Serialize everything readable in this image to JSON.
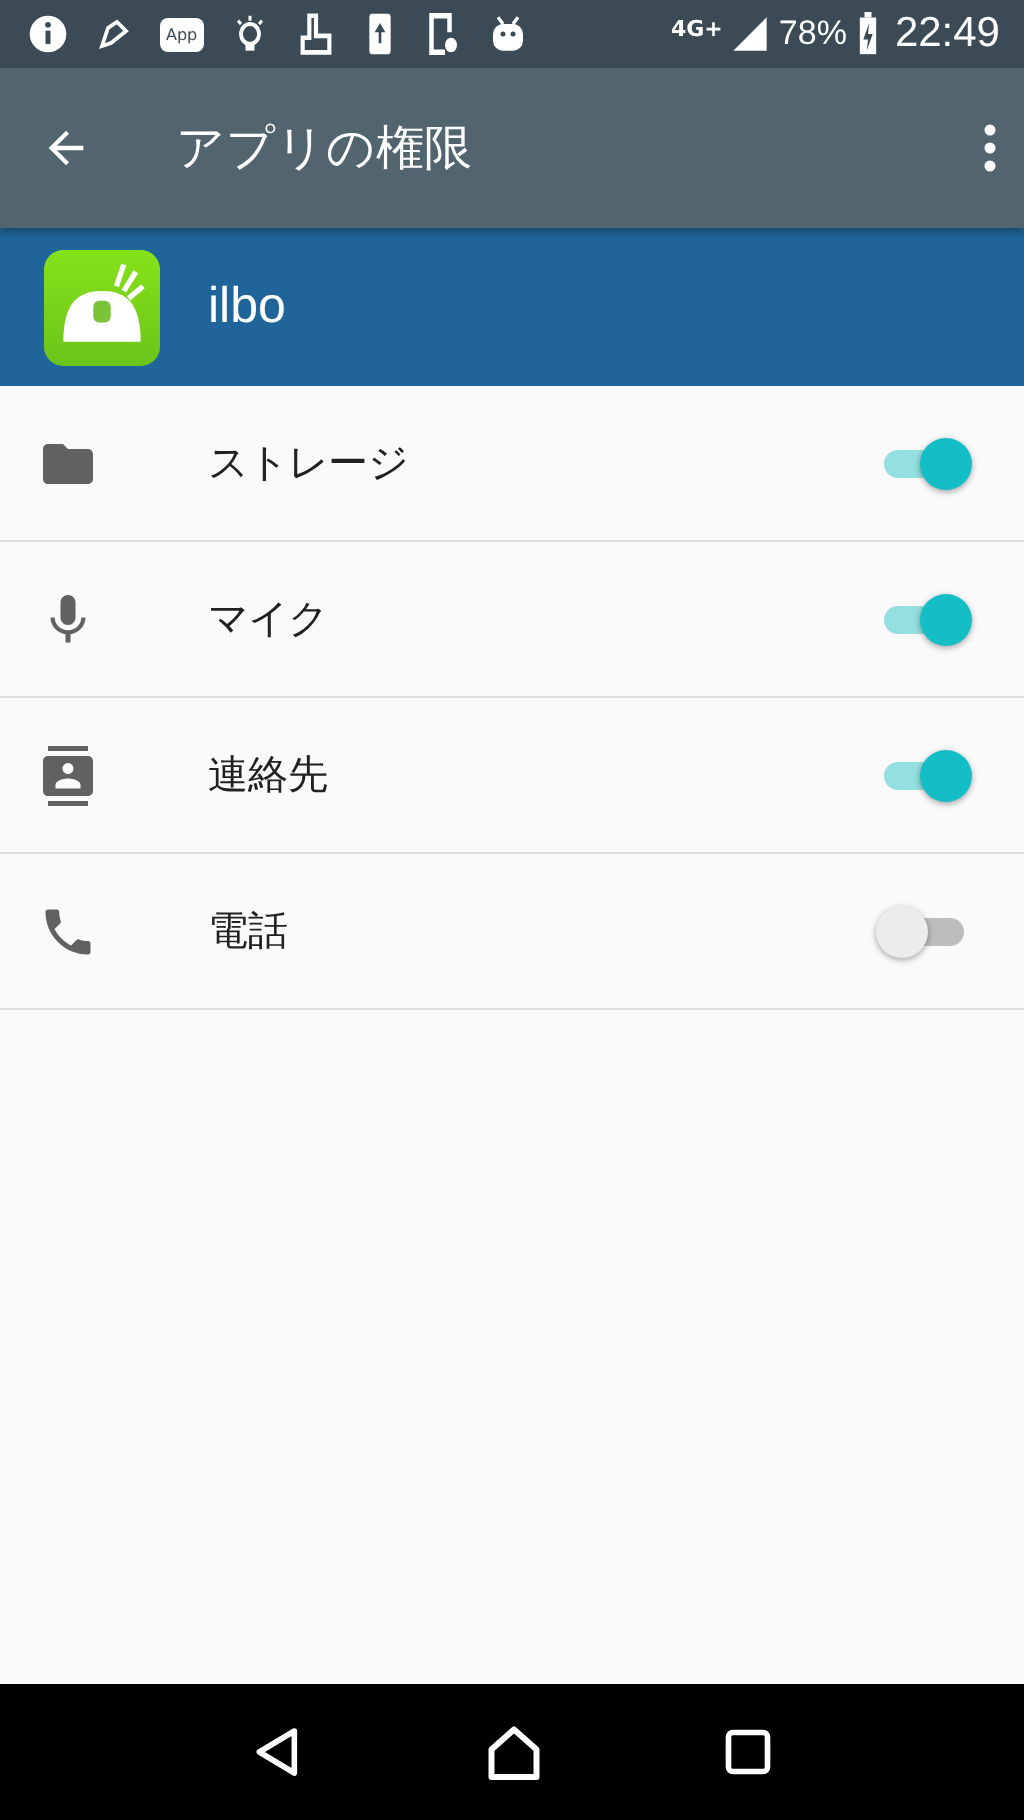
{
  "status_bar": {
    "app_badge": "App",
    "network": "4G+",
    "battery": "78%",
    "time": "22:49"
  },
  "toolbar": {
    "title": "アプリの権限"
  },
  "app": {
    "name": "ilbo"
  },
  "permissions": [
    {
      "kind": "storage",
      "label": "ストレージ",
      "on": true
    },
    {
      "kind": "microphone",
      "label": "マイク",
      "on": true
    },
    {
      "kind": "contacts",
      "label": "連絡先",
      "on": true
    },
    {
      "kind": "phone",
      "label": "電話",
      "on": false
    }
  ]
}
